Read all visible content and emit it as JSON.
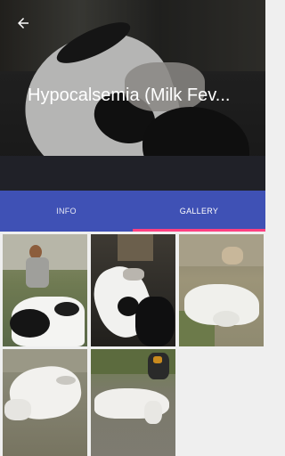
{
  "header": {
    "title": "Hypocalsemia (Milk Fev...",
    "back_icon": "arrow-back-icon"
  },
  "tabs": [
    {
      "label": "INFO",
      "selected": false
    },
    {
      "label": "GALLERY",
      "selected": true
    }
  ],
  "colors": {
    "primary": "#3f51b5",
    "accent": "#ff4081",
    "background": "#efefef"
  },
  "gallery": {
    "photo_count": 5
  }
}
